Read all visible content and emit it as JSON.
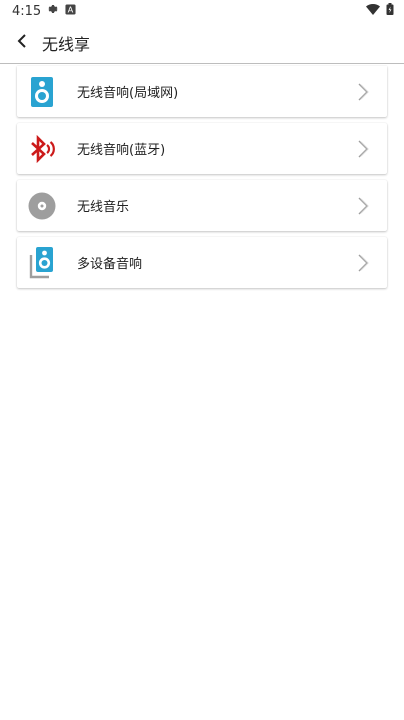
{
  "status": {
    "time": "4:15"
  },
  "appbar": {
    "title": "无线享"
  },
  "items": [
    {
      "label": "无线音响(局域网)",
      "icon": "speaker-icon"
    },
    {
      "label": "无线音响(蓝牙)",
      "icon": "bluetooth-icon"
    },
    {
      "label": "无线音乐",
      "icon": "disc-icon"
    },
    {
      "label": "多设备音响",
      "icon": "multi-speaker-icon"
    }
  ],
  "colors": {
    "speaker": "#29a3d1",
    "bluetooth": "#cc1a1a",
    "disc": "#9e9e9e",
    "divider": "#bdbdbd"
  }
}
